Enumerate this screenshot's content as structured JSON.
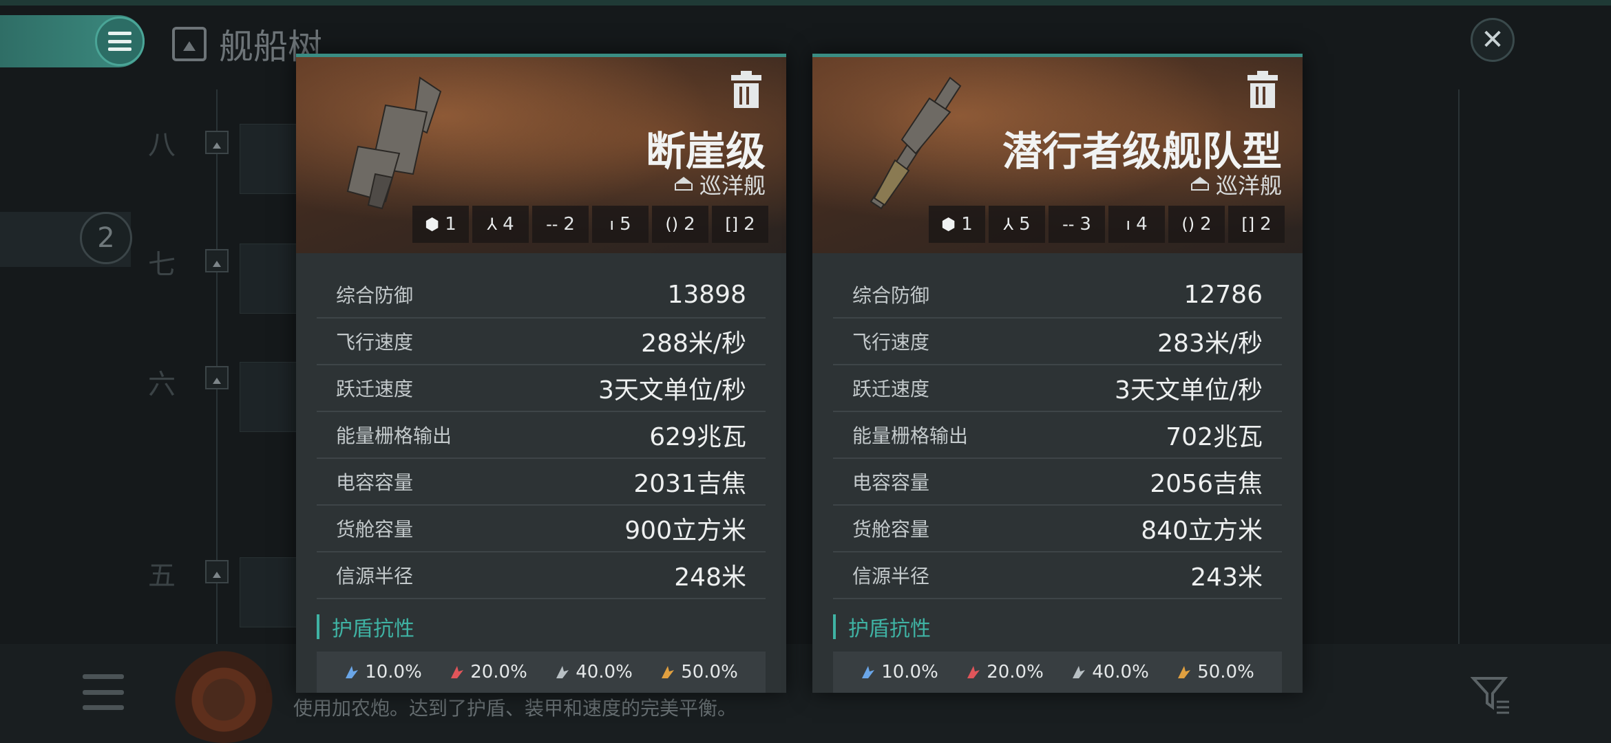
{
  "app": {
    "title": "舰船树",
    "tiers": [
      "八",
      "七",
      "六",
      "五"
    ],
    "selected_count": "2",
    "description": "使用加农炮。达到了护盾、装甲和速度的完美平衡。"
  },
  "ships": [
    {
      "name": "断崖级",
      "class": "巡洋舰",
      "slots": [
        {
          "icon": "drone-bay-icon",
          "count": "1"
        },
        {
          "icon": "high-slot-icon",
          "count": "4"
        },
        {
          "icon": "mid-slot-icon",
          "count": "2"
        },
        {
          "icon": "low-slot-icon",
          "count": "5"
        },
        {
          "icon": "rig-slot-icon",
          "count": "2"
        },
        {
          "icon": "subsystem-slot-icon",
          "count": "2"
        }
      ],
      "stats": [
        {
          "label": "综合防御",
          "value": "13898"
        },
        {
          "label": "飞行速度",
          "value": "288米/秒"
        },
        {
          "label": "跃迁速度",
          "value": "3天文单位/秒"
        },
        {
          "label": "能量栅格输出",
          "value": "629兆瓦"
        },
        {
          "label": "电容容量",
          "value": "2031吉焦"
        },
        {
          "label": "货舱容量",
          "value": "900立方米"
        },
        {
          "label": "信源半径",
          "value": "248米"
        }
      ],
      "section_title": "护盾抗性",
      "resistances": [
        {
          "type": "em",
          "value": "10.0%",
          "color": "#6aa6e8"
        },
        {
          "type": "thermal",
          "value": "20.0%",
          "color": "#e0555a"
        },
        {
          "type": "kinetic",
          "value": "40.0%",
          "color": "#b8c0c4"
        },
        {
          "type": "explosive",
          "value": "50.0%",
          "color": "#e0a040"
        }
      ]
    },
    {
      "name": "潜行者级舰队型",
      "class": "巡洋舰",
      "slots": [
        {
          "icon": "drone-bay-icon",
          "count": "1"
        },
        {
          "icon": "high-slot-icon",
          "count": "5"
        },
        {
          "icon": "mid-slot-icon",
          "count": "3"
        },
        {
          "icon": "low-slot-icon",
          "count": "4"
        },
        {
          "icon": "rig-slot-icon",
          "count": "2"
        },
        {
          "icon": "subsystem-slot-icon",
          "count": "2"
        }
      ],
      "stats": [
        {
          "label": "综合防御",
          "value": "12786"
        },
        {
          "label": "飞行速度",
          "value": "283米/秒"
        },
        {
          "label": "跃迁速度",
          "value": "3天文单位/秒"
        },
        {
          "label": "能量栅格输出",
          "value": "702兆瓦"
        },
        {
          "label": "电容容量",
          "value": "2056吉焦"
        },
        {
          "label": "货舱容量",
          "value": "840立方米"
        },
        {
          "label": "信源半径",
          "value": "243米"
        }
      ],
      "section_title": "护盾抗性",
      "resistances": [
        {
          "type": "em",
          "value": "10.0%",
          "color": "#6aa6e8"
        },
        {
          "type": "thermal",
          "value": "20.0%",
          "color": "#e0555a"
        },
        {
          "type": "kinetic",
          "value": "40.0%",
          "color": "#b8c0c4"
        },
        {
          "type": "explosive",
          "value": "50.0%",
          "color": "#e0a040"
        }
      ]
    }
  ],
  "colors": {
    "accent": "#3fb3a4",
    "menu": "#3c8b80"
  }
}
